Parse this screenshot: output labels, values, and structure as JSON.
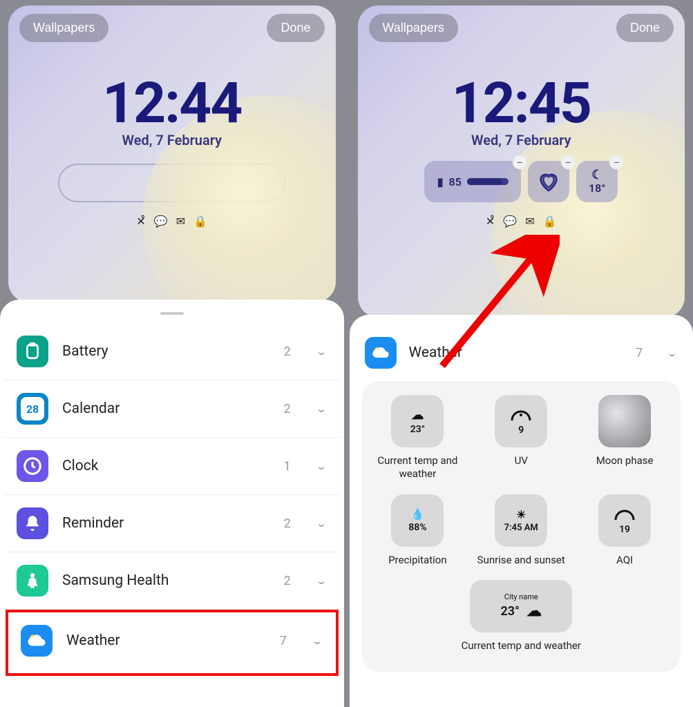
{
  "left": {
    "top": {
      "wallpapers": "Wallpapers",
      "done": "Done"
    },
    "clock": {
      "time": "12:44",
      "date": "Wed, 7 February"
    },
    "categories": [
      {
        "key": "battery",
        "label": "Battery",
        "count": "2",
        "color": "#0aa38a",
        "icon": "battery"
      },
      {
        "key": "calendar",
        "label": "Calendar",
        "count": "2",
        "color": "#0a87c6",
        "icon": "calendar",
        "badge": "28"
      },
      {
        "key": "clock",
        "label": "Clock",
        "count": "1",
        "color": "#6d56e8",
        "icon": "clock"
      },
      {
        "key": "reminder",
        "label": "Reminder",
        "count": "2",
        "color": "#5b50e0",
        "icon": "bell"
      },
      {
        "key": "health",
        "label": "Samsung Health",
        "count": "2",
        "color": "#1fc996",
        "icon": "health"
      },
      {
        "key": "weather",
        "label": "Weather",
        "count": "7",
        "color": "#1a8ef0",
        "icon": "weather",
        "highlight": true
      }
    ]
  },
  "right": {
    "top": {
      "wallpapers": "Wallpapers",
      "done": "Done"
    },
    "clock": {
      "time": "12:45",
      "date": "Wed, 7 February"
    },
    "placed_widgets": {
      "battery": "85",
      "temp": "18°"
    },
    "sheet_header": {
      "label": "Weather",
      "count": "7"
    },
    "options": [
      {
        "key": "cur-temp",
        "value": "23°",
        "caption": "Current temp and weather"
      },
      {
        "key": "uv",
        "value": "9",
        "caption": "UV"
      },
      {
        "key": "moon",
        "value": "",
        "caption": "Moon phase"
      },
      {
        "key": "precip",
        "value": "88%",
        "caption": "Precipitation"
      },
      {
        "key": "sunrise",
        "value": "7:45 AM",
        "caption": "Sunrise and sunset"
      },
      {
        "key": "aqi",
        "value": "19",
        "caption": "AQI"
      },
      {
        "key": "cur-temp-2",
        "city": "City name",
        "value": "23°",
        "caption": "Current temp and weather"
      }
    ]
  }
}
